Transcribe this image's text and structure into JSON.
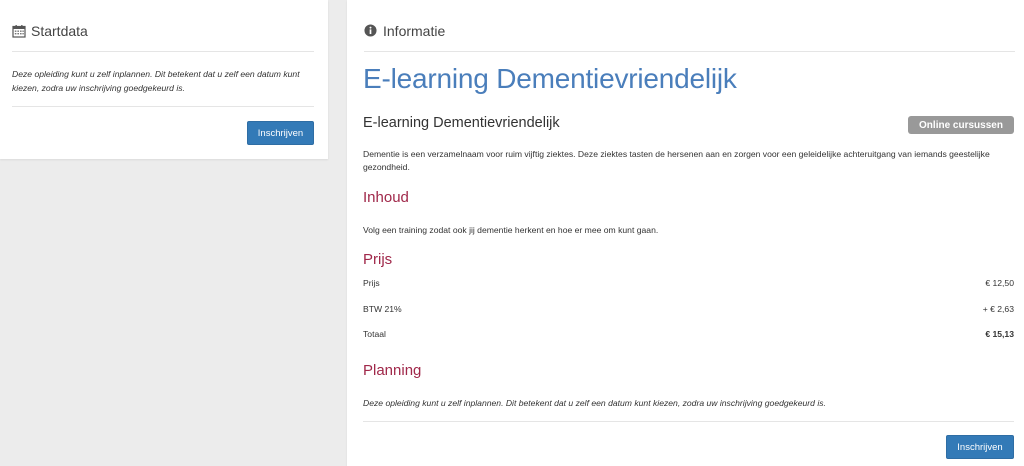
{
  "startdata": {
    "header": "Startdata",
    "note": "Deze opleiding kunt u zelf inplannen. Dit betekent dat u zelf een datum kunt kiezen, zodra uw inschrijving goedgekeurd is.",
    "button_label": "Inschrijven"
  },
  "informatie": {
    "header": "Informatie",
    "title": "E-learning Dementievriendelijk",
    "subtitle": "E-learning Dementievriendelijk",
    "badge": "Online cursussen",
    "description": "Dementie is een verzamelnaam voor ruim vijftig ziektes. Deze ziektes tasten de hersenen aan en zorgen voor een geleidelijke achteruitgang van iemands geestelijke gezondheid.",
    "inhoud": {
      "heading": "Inhoud",
      "text": "Volg een training zodat ook jij dementie herkent en hoe er mee om kunt gaan."
    },
    "prijs": {
      "heading": "Prijs",
      "rows": [
        {
          "label": "Prijs",
          "value": "€ 12,50"
        },
        {
          "label": "BTW 21%",
          "value": "+ € 2,63"
        },
        {
          "label": "Totaal",
          "value": "€ 15,13"
        }
      ]
    },
    "planning": {
      "heading": "Planning",
      "text": "Deze opleiding kunt u zelf inplannen. Dit betekent dat u zelf een datum kunt kiezen, zodra uw inschrijving goedgekeurd is."
    },
    "button_label": "Inschrijven"
  },
  "colors": {
    "accent": "#337ab7",
    "title_blue": "#4a7ebb",
    "section_red": "#a0284a",
    "badge_gray": "#999999"
  },
  "icons": {
    "startdata": "calendar-icon",
    "informatie": "info-circle-icon"
  }
}
